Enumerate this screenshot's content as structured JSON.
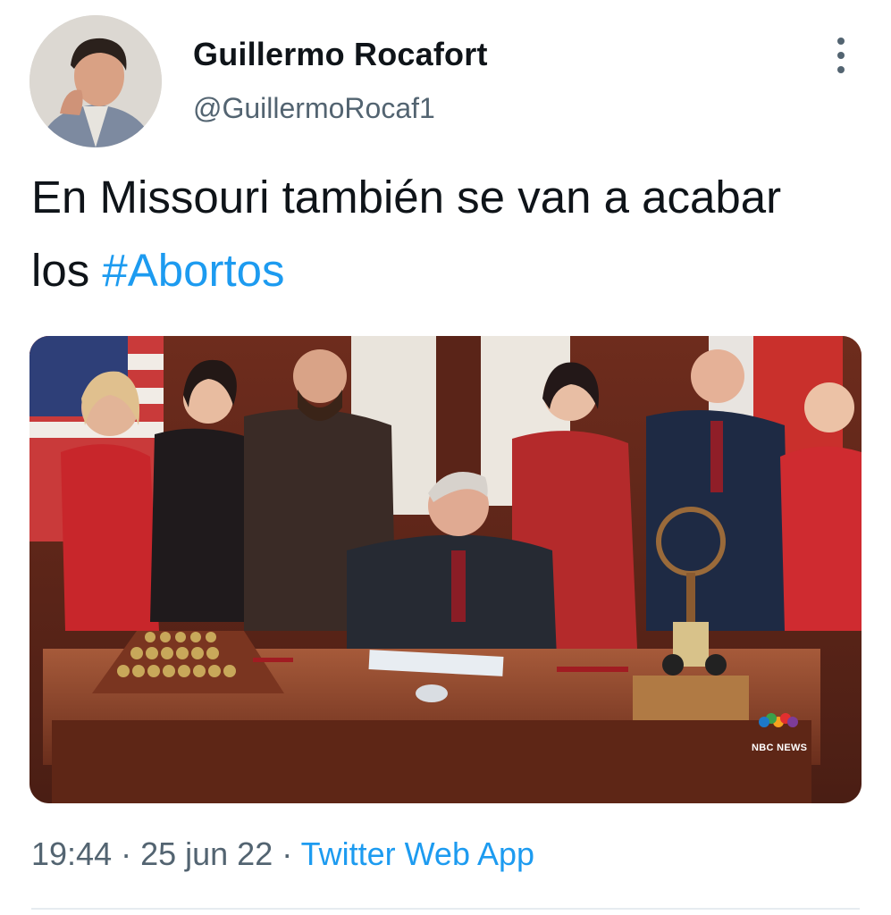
{
  "tweet": {
    "author": {
      "display_name": "Guillermo Rocafort",
      "handle": "@GuillermoRocaf1",
      "avatar": "avatar-photo"
    },
    "more_icon": "more-vertical-icon",
    "text_plain": "En Missouri también se van a acabar los ",
    "hashtag": "#Abortos",
    "media": {
      "watermark": "NBC NEWS",
      "watermark_icon": "nbc-peacock-logo"
    },
    "meta": {
      "time": "19:44",
      "separator": " · ",
      "date": "25 jun 22",
      "source": "Twitter Web App"
    }
  },
  "colors": {
    "link": "#1d9bf0",
    "secondary_text": "#536471",
    "primary_text": "#0f1419"
  }
}
